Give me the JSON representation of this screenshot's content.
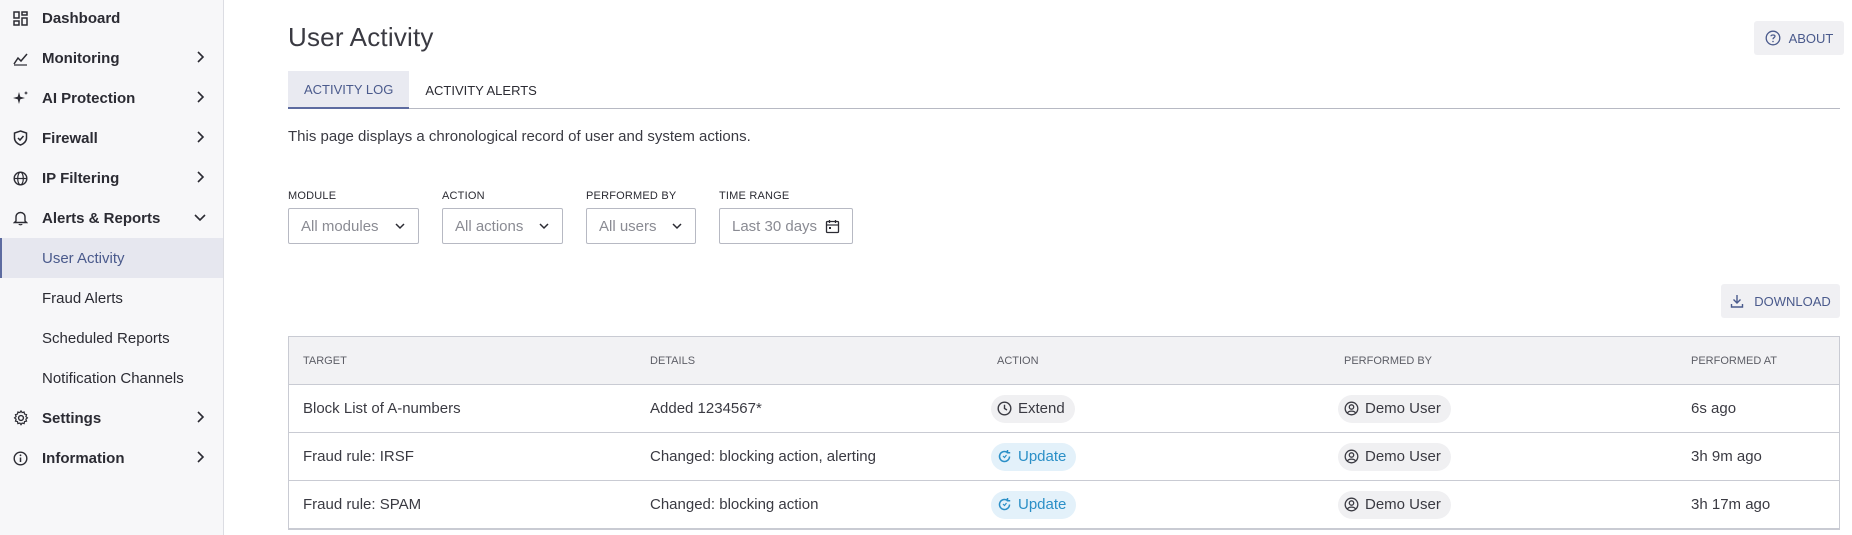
{
  "sidebar": {
    "items": [
      {
        "label": "Dashboard",
        "icon": "dashboard-icon"
      },
      {
        "label": "Monitoring",
        "icon": "chart-icon"
      },
      {
        "label": "AI Protection",
        "icon": "sparkles-icon"
      },
      {
        "label": "Firewall",
        "icon": "shield-icon"
      },
      {
        "label": "IP Filtering",
        "icon": "globe-icon"
      },
      {
        "label": "Alerts & Reports",
        "icon": "bell-icon"
      },
      {
        "label": "Settings",
        "icon": "gear-icon"
      },
      {
        "label": "Information",
        "icon": "info-icon"
      }
    ],
    "subitems": [
      {
        "label": "User Activity"
      },
      {
        "label": "Fraud Alerts"
      },
      {
        "label": "Scheduled Reports"
      },
      {
        "label": "Notification Channels"
      }
    ]
  },
  "header": {
    "title": "User Activity",
    "about_label": "ABOUT"
  },
  "tabs": [
    {
      "label": "ACTIVITY LOG"
    },
    {
      "label": "ACTIVITY ALERTS"
    }
  ],
  "description": "This page displays a chronological record of user and system actions.",
  "filters": {
    "module": {
      "label": "MODULE",
      "value": "All modules"
    },
    "action": {
      "label": "ACTION",
      "value": "All actions"
    },
    "performed_by": {
      "label": "PERFORMED BY",
      "value": "All users"
    },
    "time_range": {
      "label": "TIME RANGE",
      "value": "Last 30 days"
    }
  },
  "download_label": "DOWNLOAD",
  "table": {
    "columns": [
      "TARGET",
      "DETAILS",
      "ACTION",
      "PERFORMED BY",
      "PERFORMED AT"
    ],
    "rows": [
      {
        "target": "Block List of A-numbers",
        "details": "Added 1234567*",
        "action": "Extend",
        "performed_by": "Demo User",
        "performed_at": "6s ago"
      },
      {
        "target": "Fraud rule: IRSF",
        "details": "Changed: blocking action, alerting",
        "action": "Update",
        "performed_by": "Demo User",
        "performed_at": "3h 9m ago"
      },
      {
        "target": "Fraud rule: SPAM",
        "details": "Changed: blocking action",
        "action": "Update",
        "performed_by": "Demo User",
        "performed_at": "3h 17m ago"
      }
    ]
  },
  "colors": {
    "accent": "#4a5a8c",
    "update_chip": "#2a8fc7",
    "sidebar_bg": "#f7f7f9"
  }
}
